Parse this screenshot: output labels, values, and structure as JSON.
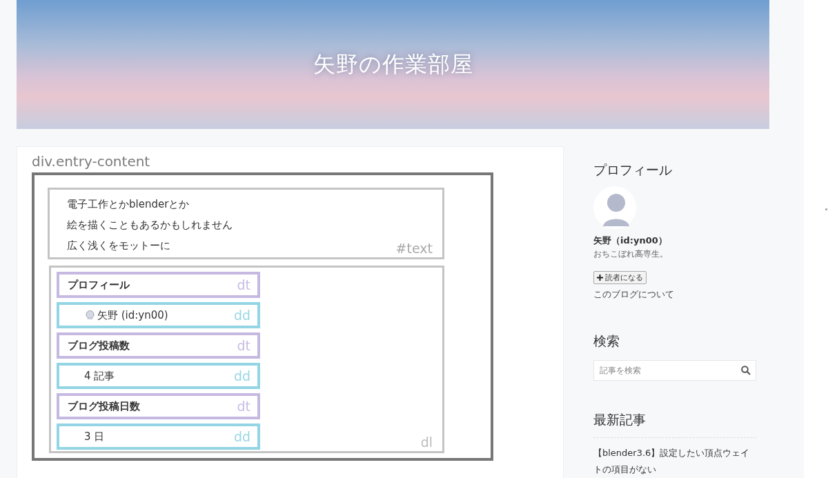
{
  "header": {
    "title": "矢野の作業部屋"
  },
  "entry": {
    "label": "div.entry-content",
    "text_block": {
      "tag": "#text",
      "lines": [
        "電子工作とかblenderとか",
        "絵を描くこともあるかもしれません",
        "広く浅くをモットーに"
      ]
    },
    "dl": {
      "tag": "dl",
      "items": [
        {
          "kind": "dt",
          "text": "プロフィール",
          "tag": "dt"
        },
        {
          "kind": "dd-user",
          "text": "矢野 (id:yn00)",
          "tag": "dd"
        },
        {
          "kind": "dt",
          "text": "ブログ投稿数",
          "tag": "dt"
        },
        {
          "kind": "dd",
          "text": "4 記事",
          "tag": "dd"
        },
        {
          "kind": "dt",
          "text": "ブログ投稿日数",
          "tag": "dt"
        },
        {
          "kind": "dd",
          "text": "3 日",
          "tag": "dd"
        }
      ]
    }
  },
  "sidebar": {
    "profile": {
      "heading": "プロフィール",
      "name": "矢野（id:yn00）",
      "description": "おちこぼれ高専生。",
      "subscribe_button": "読者になる",
      "about_link": "このブログについて"
    },
    "search": {
      "heading": "検索",
      "placeholder": "記事を検索"
    },
    "recent": {
      "heading": "最新記事",
      "articles": [
        "【blender3.6】設定したい頂点ウェイトの項目がない"
      ]
    }
  }
}
